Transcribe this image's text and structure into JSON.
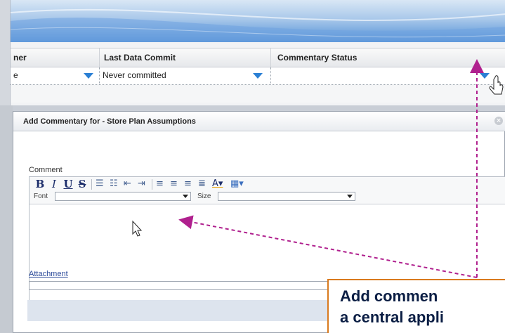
{
  "grid": {
    "columns": [
      "ner",
      "Last Data Commit",
      "Commentary Status"
    ],
    "row": {
      "owner_partial": "e",
      "last_commit": "Never committed",
      "status": ""
    }
  },
  "dialog": {
    "title": "Add Commentary for - Store Plan Assumptions",
    "comment_label": "Comment",
    "toolbar": {
      "bold": "B",
      "italic": "I",
      "underline": "U",
      "strike": "S",
      "font_label": "Font",
      "size_label": "Size",
      "font_value": "",
      "size_value": ""
    },
    "attachment_label": "Attachment"
  },
  "callout": {
    "line1": "Add commen",
    "line2": "a central appli"
  },
  "colors": {
    "accent_blue": "#2a7fd4",
    "annotation_magenta": "#b0208e",
    "callout_border": "#d97a1e"
  }
}
